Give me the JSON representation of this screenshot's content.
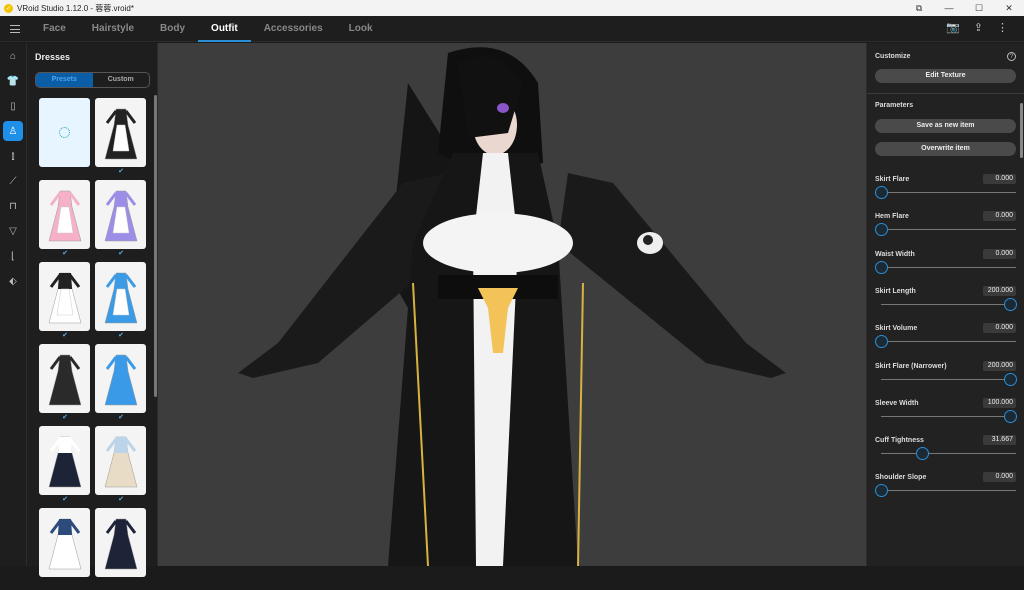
{
  "window": {
    "title": "VRoid Studio 1.12.0 - 蓉蓉.vroid*",
    "min": "—",
    "max": "☐",
    "close": "✕",
    "extra": "⧉"
  },
  "tabs": [
    {
      "label": "Face"
    },
    {
      "label": "Hairstyle"
    },
    {
      "label": "Body"
    },
    {
      "label": "Outfit",
      "active": true
    },
    {
      "label": "Accessories"
    },
    {
      "label": "Look"
    }
  ],
  "topicons": {
    "camera": "📷",
    "export": "⇪",
    "more": "⋮"
  },
  "rail": [
    {
      "icon": "tops-icon",
      "glyph": "⌂"
    },
    {
      "icon": "shirt-icon",
      "glyph": "👕"
    },
    {
      "icon": "jacket-icon",
      "glyph": "▯"
    },
    {
      "icon": "dress-icon",
      "glyph": "♙",
      "active": true
    },
    {
      "icon": "tie-icon",
      "glyph": "⫾"
    },
    {
      "icon": "gloves-icon",
      "glyph": "⟋"
    },
    {
      "icon": "bottoms-icon",
      "glyph": "⊓"
    },
    {
      "icon": "underwear-icon",
      "glyph": "▽"
    },
    {
      "icon": "socks-icon",
      "glyph": "⌊"
    },
    {
      "icon": "shoes-icon",
      "glyph": "⬖"
    }
  ],
  "dresses": {
    "title": "Dresses",
    "presets": "Presets",
    "custom": "Custom",
    "check": "✔",
    "items": [
      {
        "selected": true,
        "checked": false
      },
      {
        "color": "#222",
        "apron": "#fff",
        "checked": true
      },
      {
        "color": "#f6b0c8",
        "apron": "#fff",
        "checked": true
      },
      {
        "color": "#9c8ee6",
        "apron": "#fff",
        "checked": true
      },
      {
        "color": "#fff",
        "apron": "#fff",
        "top": "#222",
        "checked": true
      },
      {
        "color": "#3b9be6",
        "apron": "#fff",
        "checked": true
      },
      {
        "color": "#2a2a2a",
        "checked": true
      },
      {
        "color": "#3a9ae8",
        "checked": true
      },
      {
        "color": "#1e2438",
        "top": "#fff",
        "checked": true
      },
      {
        "color": "#e8dcc6",
        "top": "#bcd4e8",
        "checked": true
      },
      {
        "color": "#fff",
        "top": "#2c4a7a",
        "checked": false
      },
      {
        "color": "#1e2438",
        "checked": false
      }
    ]
  },
  "customize": {
    "title": "Customize",
    "help": "?",
    "edit_texture": "Edit Texture"
  },
  "parameters": {
    "title": "Parameters",
    "save_new": "Save as new item",
    "overwrite": "Overwrite item",
    "items": [
      {
        "label": "Skirt Flare",
        "value": "0.000",
        "fraction": 0
      },
      {
        "label": "Hem Flare",
        "value": "0.000",
        "fraction": 0
      },
      {
        "label": "Waist Width",
        "value": "0.000",
        "fraction": 0
      },
      {
        "label": "Skirt Length",
        "value": "200.000",
        "fraction": 1
      },
      {
        "label": "Skirt Volume",
        "value": "0.000",
        "fraction": 0
      },
      {
        "label": "Skirt Flare (Narrower)",
        "value": "200.000",
        "fraction": 1
      },
      {
        "label": "Sleeve Width",
        "value": "100.000",
        "fraction": 1
      },
      {
        "label": "Cuff Tightness",
        "value": "31.667",
        "fraction": 0.32
      },
      {
        "label": "Shoulder Slope",
        "value": "0.000",
        "fraction": 0
      }
    ]
  }
}
